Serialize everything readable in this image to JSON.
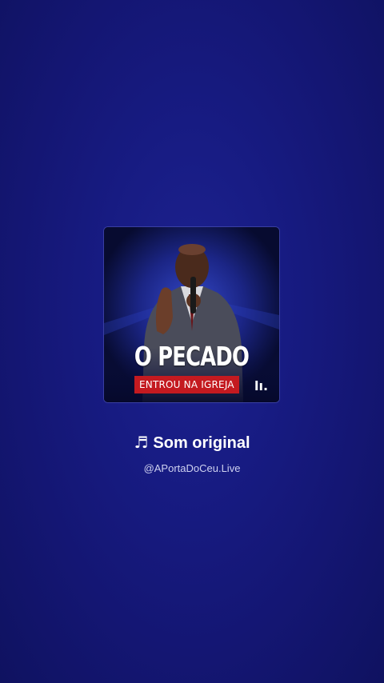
{
  "sound": {
    "title": "Som original",
    "author": "@APortaDoCeu.Live",
    "note_icon": "music-note-icon"
  },
  "cover": {
    "title": "O PECADO",
    "subtitle": "ENTROU NA IGREJA",
    "mark": "lı.",
    "banner_color": "#c41a20"
  },
  "colors": {
    "background": "#171b82",
    "text": "#ffffff",
    "muted_text": "#cfd2f0"
  }
}
